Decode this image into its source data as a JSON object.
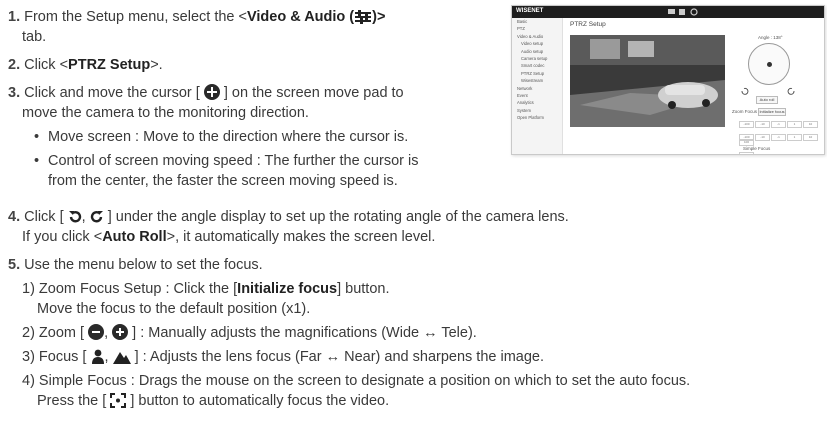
{
  "steps": {
    "s1": {
      "num": "1.",
      "a": "From the Setup menu, select the <",
      "b": "Video & Audio (",
      "c": ")>",
      "d": "tab."
    },
    "s2": {
      "num": "2.",
      "a": "Click <",
      "b": "PTRZ Setup",
      "c": ">."
    },
    "s3": {
      "num": "3.",
      "a": "Click and move the cursor [",
      "b": "] on the screen move pad to",
      "c": "move the camera to the monitoring direction."
    },
    "bullet1": "Move screen : Move to the direction where the cursor is.",
    "bullet2a": "Control of screen moving speed : The further the cursor is",
    "bullet2b": "from the center, the faster the screen moving speed is.",
    "s4": {
      "num": "4.",
      "a": "Click [",
      "sep": ",",
      "b": "] under the angle display to set up the rotating angle of the camera lens.",
      "c": "If you click <",
      "d": "Auto Roll",
      "e": ">, it automatically makes the screen level."
    },
    "s5": {
      "num": "5.",
      "a": "Use the menu below to set the focus."
    },
    "sub1": {
      "a": "1) Zoom Focus Setup : Click the [",
      "b": "Initialize focus",
      "c": "] button.",
      "d": "Move the focus to the default position (x1)."
    },
    "sub2": {
      "a": "2) Zoom [",
      "sep": ",",
      "b": "] : Manually adjusts the magnifications (Wide ↔ Tele)."
    },
    "sub3": {
      "a": "3) Focus [",
      "sep": ",",
      "b": "] : Adjusts the lens focus (Far ↔ Near) and sharpens the image."
    },
    "sub4": {
      "a": "4) Simple Focus : Drags the mouse on the screen to designate a position on which to set the auto focus.",
      "b": "Press the [",
      "c": "] button to automatically focus the video."
    }
  },
  "screenshot": {
    "brand": "WISENET",
    "page_title": "PTRZ Setup",
    "menu": [
      "Basic",
      "PTZ",
      "Video & Audio",
      "Video setup",
      "Audio setup",
      "Camera setup",
      "Smart codec",
      "PTRZ Setup",
      "Wisestream",
      "Network",
      "Event",
      "Analytics",
      "System",
      "Open Platform"
    ],
    "angle_label": "Angle : 138°",
    "auto_roll": "Auto roll",
    "zoom_focus_label": "Zoom Focus Setup",
    "init_focus": "Initialize focus",
    "step_values": [
      "-100",
      "-10",
      "-1",
      "1",
      "10",
      "100"
    ],
    "simple_focus": "Simple Focus"
  },
  "icons": [
    "video-audio-icon",
    "move-cursor-icon",
    "rotate-left-icon",
    "rotate-right-icon",
    "zoom-out-icon",
    "zoom-in-icon",
    "focus-far-icon",
    "focus-near-icon",
    "simple-focus-icon"
  ]
}
